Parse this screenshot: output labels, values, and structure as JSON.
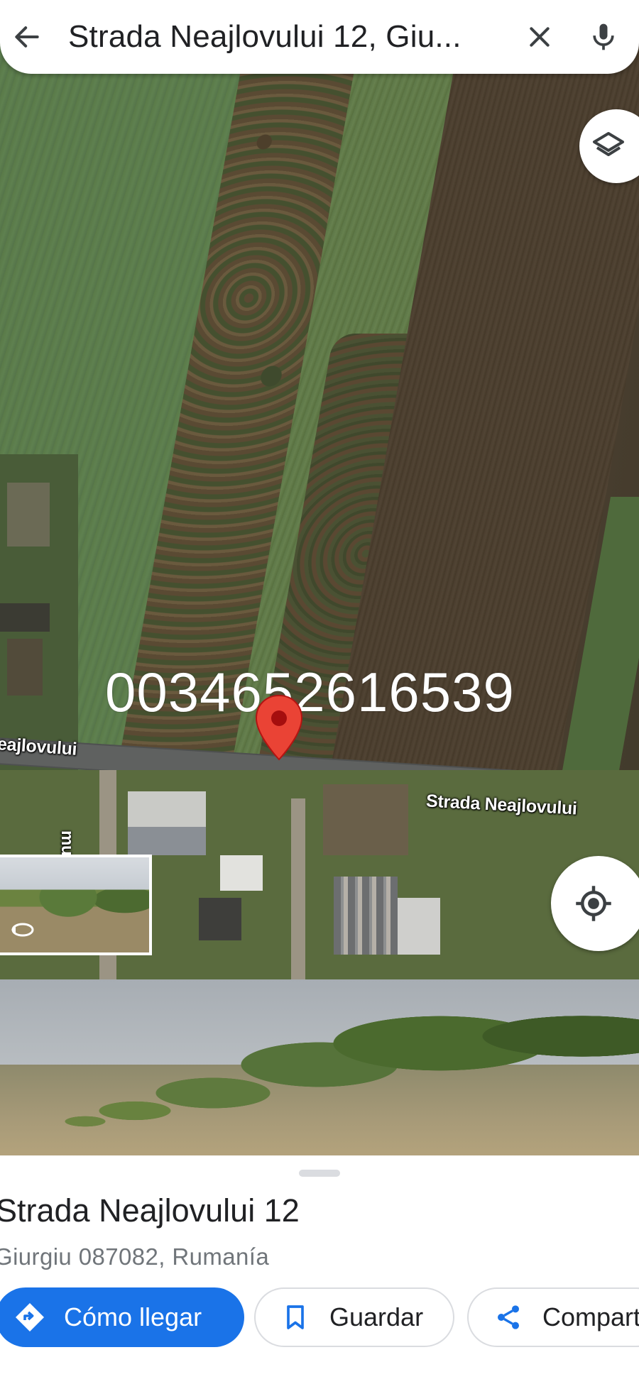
{
  "search": {
    "query": "Strada Neajlovului 12, Giu...",
    "back_icon": "arrow-back-icon",
    "clear_icon": "close-icon",
    "mic_icon": "mic-icon"
  },
  "map": {
    "overlay_text": "0034652616539",
    "road_labels": {
      "left": "eajlovului",
      "right": "Strada Neajlovului",
      "vertical": "mului"
    },
    "pin_color": "#ea4335",
    "layers_icon": "layers-icon",
    "location_icon": "my-location-icon",
    "streetview_icon": "street-view-rotate-icon"
  },
  "place": {
    "title": "Strada Neajlovului 12",
    "address": "Giurgiu 087082, Rumanía"
  },
  "actions": {
    "directions_label": "Cómo llegar",
    "save_label": "Guardar",
    "share_label": "Compartir",
    "accent_color": "#1a73e8"
  }
}
